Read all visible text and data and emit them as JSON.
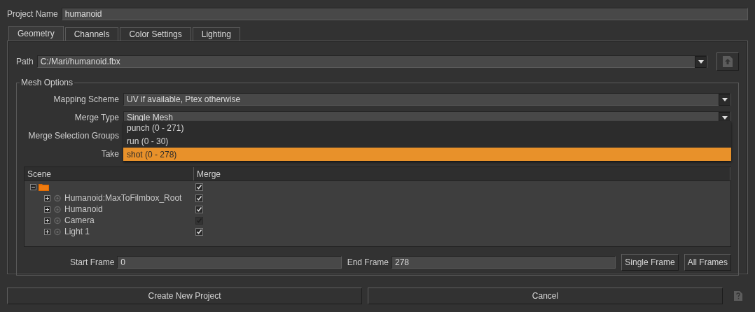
{
  "project_name": {
    "label": "Project Name",
    "value": "humanoid"
  },
  "tabs": [
    {
      "label": "Geometry",
      "selected": true
    },
    {
      "label": "Channels",
      "selected": false
    },
    {
      "label": "Color Settings",
      "selected": false
    },
    {
      "label": "Lighting",
      "selected": false
    }
  ],
  "path": {
    "label": "Path",
    "value": "C:/Mari/humanoid.fbx"
  },
  "mesh_options": {
    "title": "Mesh Options",
    "fields": [
      {
        "label": "Mapping Scheme",
        "value": "UV if available, Ptex otherwise",
        "kind": "combo"
      },
      {
        "label": "Merge Type",
        "value": "Single Mesh",
        "kind": "combo"
      },
      {
        "label": "Merge Selection Groups",
        "kind": "covered"
      },
      {
        "label": "Take",
        "kind": "covered"
      }
    ],
    "take_dropdown": [
      {
        "label": "punch (0 - 271)",
        "selected": false
      },
      {
        "label": "run (0 - 30)",
        "selected": false
      },
      {
        "label": "shot (0 - 278)",
        "selected": true
      }
    ],
    "tree": {
      "columns": [
        "Scene",
        "Merge"
      ],
      "nodes": [
        {
          "kind": "folder",
          "expanded": true,
          "checked": true,
          "disabled": false,
          "children": [
            {
              "kind": "node",
              "label": "Humanoid:MaxToFilmbox_Root",
              "expanded": false,
              "checked": true,
              "disabled": false
            },
            {
              "kind": "node",
              "label": "Humanoid",
              "expanded": false,
              "checked": true,
              "disabled": false
            },
            {
              "kind": "node",
              "label": "Camera",
              "expanded": false,
              "checked": true,
              "disabled": true
            },
            {
              "kind": "node",
              "label": "Light 1",
              "expanded": false,
              "checked": true,
              "disabled": false
            }
          ]
        }
      ]
    },
    "frames": {
      "start_label": "Start Frame",
      "start_value": "0",
      "end_label": "End Frame",
      "end_value": "278",
      "buttons": [
        "Single Frame",
        "All Frames"
      ]
    }
  },
  "footer_buttons": [
    "Create New Project",
    "Cancel"
  ]
}
